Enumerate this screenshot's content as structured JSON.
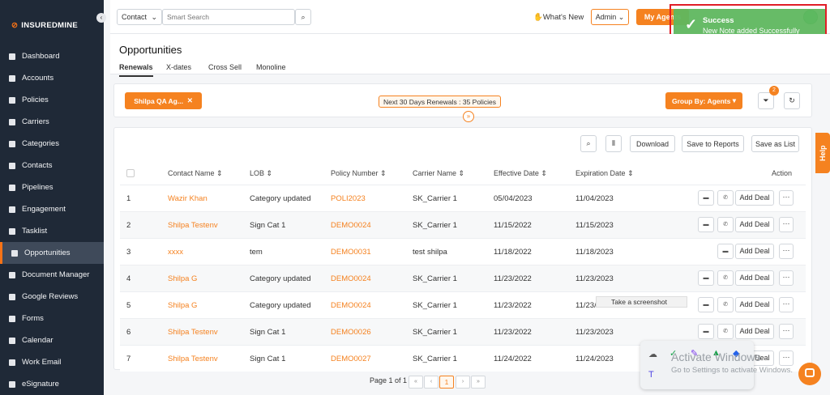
{
  "app": {
    "name": "INSUREDMINE"
  },
  "sidebar": {
    "items": [
      {
        "label": "Dashboard",
        "icon": "dashboard-icon"
      },
      {
        "label": "Accounts",
        "icon": "accounts-icon"
      },
      {
        "label": "Policies",
        "icon": "policies-icon"
      },
      {
        "label": "Carriers",
        "icon": "carriers-icon"
      },
      {
        "label": "Categories",
        "icon": "categories-icon"
      },
      {
        "label": "Contacts",
        "icon": "contacts-icon"
      },
      {
        "label": "Pipelines",
        "icon": "pipelines-icon"
      },
      {
        "label": "Engagement",
        "icon": "engagement-icon"
      },
      {
        "label": "Tasklist",
        "icon": "tasklist-icon"
      },
      {
        "label": "Opportunities",
        "icon": "opportunities-icon",
        "active": true
      },
      {
        "label": "Document Manager",
        "icon": "document-icon"
      },
      {
        "label": "Google Reviews",
        "icon": "google-icon"
      },
      {
        "label": "Forms",
        "icon": "forms-icon"
      },
      {
        "label": "Calendar",
        "icon": "calendar-icon"
      },
      {
        "label": "Work Email",
        "icon": "email-icon"
      },
      {
        "label": "eSignature",
        "icon": "signature-icon"
      }
    ]
  },
  "topbar": {
    "search_scope": "Contact",
    "search_placeholder": "Smart Search",
    "whats_new": "What's New",
    "role": "Admin",
    "my_agents": "My Agents"
  },
  "toast": {
    "title": "Success",
    "message": "New Note added Successfully",
    "color": "#5fb85f"
  },
  "page": {
    "title": "Opportunities",
    "tabs": [
      "Renewals",
      "X-dates",
      "Cross Sell",
      "Monoline"
    ],
    "active_tab": "Renewals"
  },
  "filters": {
    "agent_chip": "Shilpa QA Ag...",
    "renewals_summary": "Next 30 Days Renewals : 35 Policies",
    "group_by": "Group By: Agents",
    "filter_count": "2"
  },
  "toolbar": {
    "download": "Download",
    "save_reports": "Save to Reports",
    "save_list": "Save as List"
  },
  "table": {
    "columns": [
      "Contact Name",
      "LOB",
      "Policy Number",
      "Carrier Name",
      "Effective Date",
      "Expiration Date",
      "Action"
    ],
    "add_deal_label": "Add Deal",
    "rows": [
      {
        "n": "1",
        "contact": "Wazir Khan",
        "lob": "Category updated",
        "policy": "POLI2023",
        "carrier": "SK_Carrier 1",
        "eff": "05/04/2023",
        "exp": "11/04/2023",
        "phone": true
      },
      {
        "n": "2",
        "contact": "Shilpa Testenv",
        "lob": "Sign Cat 1",
        "policy": "DEMO0024",
        "carrier": "SK_Carrier 1",
        "eff": "11/15/2022",
        "exp": "11/15/2023",
        "phone": true
      },
      {
        "n": "3",
        "contact": "xxxx",
        "lob": "tem",
        "policy": "DEMO0031",
        "carrier": "test shilpa",
        "eff": "11/18/2022",
        "exp": "11/18/2023",
        "phone": false
      },
      {
        "n": "4",
        "contact": "Shilpa G",
        "lob": "Category updated",
        "policy": "DEMO0024",
        "carrier": "SK_Carrier 1",
        "eff": "11/23/2022",
        "exp": "11/23/2023",
        "phone": true
      },
      {
        "n": "5",
        "contact": "Shilpa G",
        "lob": "Category updated",
        "policy": "DEMO0024",
        "carrier": "SK_Carrier 1",
        "eff": "11/23/2022",
        "exp": "11/23/2023",
        "phone": true
      },
      {
        "n": "6",
        "contact": "Shilpa Testenv",
        "lob": "Sign Cat 1",
        "policy": "DEMO0026",
        "carrier": "SK_Carrier 1",
        "eff": "11/23/2022",
        "exp": "11/23/2023",
        "phone": true
      },
      {
        "n": "7",
        "contact": "Shilpa Testenv",
        "lob": "Sign Cat 1",
        "policy": "DEMO0027",
        "carrier": "SK_Carrier 1",
        "eff": "11/24/2022",
        "exp": "11/24/2023",
        "phone": true
      }
    ]
  },
  "pager": {
    "text": "Page 1 of 1",
    "current": "1"
  },
  "tooltip": "Take a screenshot",
  "help": "Help",
  "watermark": {
    "line1": "Activate Windows",
    "line2": "Go to Settings to activate Windows."
  }
}
